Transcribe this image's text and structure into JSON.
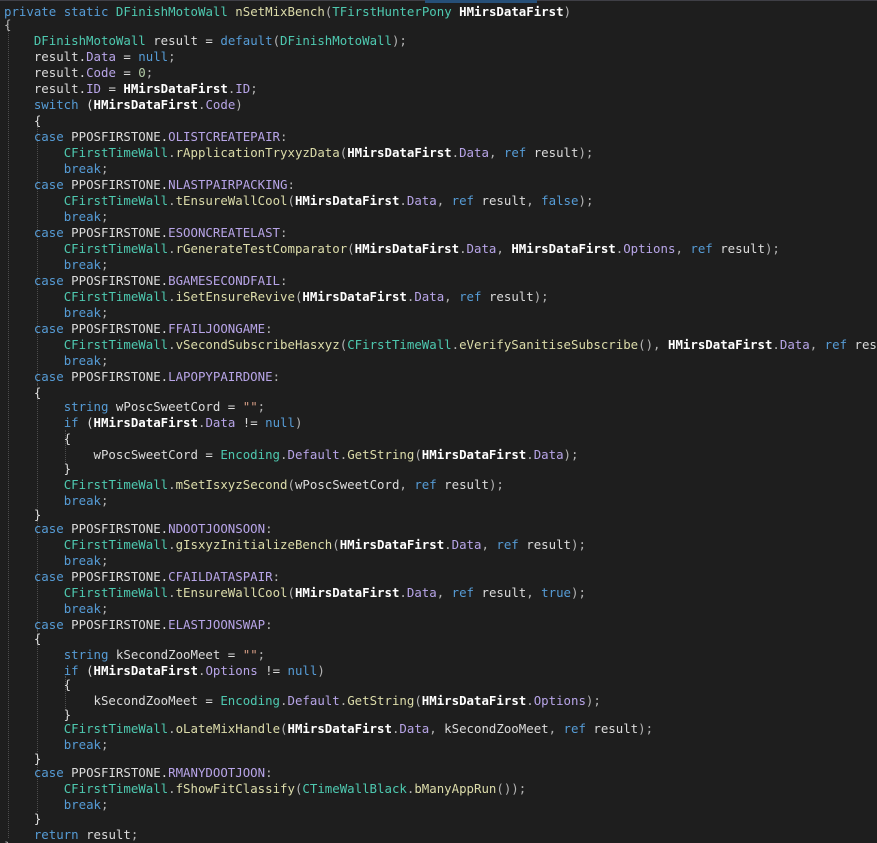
{
  "editor": {
    "language": "csharp",
    "colors": {
      "background": "#1e1e1e",
      "keyword": "#569cd6",
      "type": "#4ec9b0",
      "method": "#dcdcaa",
      "member": "#b8a5e8",
      "string": "#d69d85",
      "number": "#b5cea8",
      "text": "#dcdcdc"
    },
    "lines": [
      [
        [
          "kw",
          "private"
        ],
        [
          "var",
          " "
        ],
        [
          "kw",
          "static"
        ],
        [
          "var",
          " "
        ],
        [
          "ty",
          "DFinishMotoWall"
        ],
        [
          "var",
          " "
        ],
        [
          "fn",
          "nSetMixBench"
        ],
        [
          "pun",
          "("
        ],
        [
          "ty",
          "TFirstHunterPony"
        ],
        [
          "var",
          " "
        ],
        [
          "bold",
          "HMirsDataFirst"
        ],
        [
          "pun",
          ")"
        ]
      ],
      [
        [
          "pun",
          "{"
        ]
      ],
      [
        [
          "var",
          "    "
        ],
        [
          "ty",
          "DFinishMotoWall"
        ],
        [
          "var",
          " result = "
        ],
        [
          "kw",
          "default"
        ],
        [
          "pun",
          "("
        ],
        [
          "ty",
          "DFinishMotoWall"
        ],
        [
          "pun",
          ");"
        ]
      ],
      [
        [
          "var",
          "    result."
        ],
        [
          "pr",
          "Data"
        ],
        [
          "var",
          " = "
        ],
        [
          "kw",
          "null"
        ],
        [
          "pun",
          ";"
        ]
      ],
      [
        [
          "var",
          "    result."
        ],
        [
          "pr",
          "Code"
        ],
        [
          "var",
          " = "
        ],
        [
          "num",
          "0"
        ],
        [
          "pun",
          ";"
        ]
      ],
      [
        [
          "var",
          "    result."
        ],
        [
          "pr",
          "ID"
        ],
        [
          "var",
          " = "
        ],
        [
          "bold",
          "HMirsDataFirst"
        ],
        [
          "pun",
          "."
        ],
        [
          "pr",
          "ID"
        ],
        [
          "pun",
          ";"
        ]
      ],
      [
        [
          "var",
          "    "
        ],
        [
          "kw",
          "switch"
        ],
        [
          "var",
          " ("
        ],
        [
          "bold",
          "HMirsDataFirst"
        ],
        [
          "pun",
          "."
        ],
        [
          "pr",
          "Code"
        ],
        [
          "pun",
          ")"
        ]
      ],
      [
        [
          "var",
          "    {"
        ]
      ],
      [
        [
          "var",
          "    "
        ],
        [
          "kw",
          "case"
        ],
        [
          "var",
          " PPOSFIRSTONE."
        ],
        [
          "pr",
          "OLISTCREATEPAIR"
        ],
        [
          "pun",
          ":"
        ]
      ],
      [
        [
          "var",
          "        "
        ],
        [
          "ty",
          "CFirstTimeWall"
        ],
        [
          "pun",
          "."
        ],
        [
          "fn",
          "rApplicationTryxyzData"
        ],
        [
          "pun",
          "("
        ],
        [
          "bold",
          "HMirsDataFirst"
        ],
        [
          "pun",
          "."
        ],
        [
          "pr",
          "Data"
        ],
        [
          "pun",
          ", "
        ],
        [
          "kw",
          "ref"
        ],
        [
          "var",
          " result"
        ],
        [
          "pun",
          ");"
        ]
      ],
      [
        [
          "var",
          "        "
        ],
        [
          "kw",
          "break"
        ],
        [
          "pun",
          ";"
        ]
      ],
      [
        [
          "var",
          "    "
        ],
        [
          "kw",
          "case"
        ],
        [
          "var",
          " PPOSFIRSTONE."
        ],
        [
          "pr",
          "NLASTPAIRPACKING"
        ],
        [
          "pun",
          ":"
        ]
      ],
      [
        [
          "var",
          "        "
        ],
        [
          "ty",
          "CFirstTimeWall"
        ],
        [
          "pun",
          "."
        ],
        [
          "fn",
          "tEnsureWallCool"
        ],
        [
          "pun",
          "("
        ],
        [
          "bold",
          "HMirsDataFirst"
        ],
        [
          "pun",
          "."
        ],
        [
          "pr",
          "Data"
        ],
        [
          "pun",
          ", "
        ],
        [
          "kw",
          "ref"
        ],
        [
          "var",
          " result"
        ],
        [
          "pun",
          ", "
        ],
        [
          "kw",
          "false"
        ],
        [
          "pun",
          ");"
        ]
      ],
      [
        [
          "var",
          "        "
        ],
        [
          "kw",
          "break"
        ],
        [
          "pun",
          ";"
        ]
      ],
      [
        [
          "var",
          "    "
        ],
        [
          "kw",
          "case"
        ],
        [
          "var",
          " PPOSFIRSTONE."
        ],
        [
          "pr",
          "ESOONCREATELAST"
        ],
        [
          "pun",
          ":"
        ]
      ],
      [
        [
          "var",
          "        "
        ],
        [
          "ty",
          "CFirstTimeWall"
        ],
        [
          "pun",
          "."
        ],
        [
          "fn",
          "rGenerateTestComparator"
        ],
        [
          "pun",
          "("
        ],
        [
          "bold",
          "HMirsDataFirst"
        ],
        [
          "pun",
          "."
        ],
        [
          "pr",
          "Data"
        ],
        [
          "pun",
          ", "
        ],
        [
          "bold",
          "HMirsDataFirst"
        ],
        [
          "pun",
          "."
        ],
        [
          "pr",
          "Options"
        ],
        [
          "pun",
          ", "
        ],
        [
          "kw",
          "ref"
        ],
        [
          "var",
          " result"
        ],
        [
          "pun",
          ");"
        ]
      ],
      [
        [
          "var",
          "        "
        ],
        [
          "kw",
          "break"
        ],
        [
          "pun",
          ";"
        ]
      ],
      [
        [
          "var",
          "    "
        ],
        [
          "kw",
          "case"
        ],
        [
          "var",
          " PPOSFIRSTONE."
        ],
        [
          "pr",
          "BGAMESECONDFAIL"
        ],
        [
          "pun",
          ":"
        ]
      ],
      [
        [
          "var",
          "        "
        ],
        [
          "ty",
          "CFirstTimeWall"
        ],
        [
          "pun",
          "."
        ],
        [
          "fn",
          "iSetEnsureRevive"
        ],
        [
          "pun",
          "("
        ],
        [
          "bold",
          "HMirsDataFirst"
        ],
        [
          "pun",
          "."
        ],
        [
          "pr",
          "Data"
        ],
        [
          "pun",
          ", "
        ],
        [
          "kw",
          "ref"
        ],
        [
          "var",
          " result"
        ],
        [
          "pun",
          ");"
        ]
      ],
      [
        [
          "var",
          "        "
        ],
        [
          "kw",
          "break"
        ],
        [
          "pun",
          ";"
        ]
      ],
      [
        [
          "var",
          "    "
        ],
        [
          "kw",
          "case"
        ],
        [
          "var",
          " PPOSFIRSTONE."
        ],
        [
          "pr",
          "FFAILJOONGAME"
        ],
        [
          "pun",
          ":"
        ]
      ],
      [
        [
          "var",
          "        "
        ],
        [
          "ty",
          "CFirstTimeWall"
        ],
        [
          "pun",
          "."
        ],
        [
          "fn",
          "vSecondSubscribeHasxyz"
        ],
        [
          "pun",
          "("
        ],
        [
          "ty",
          "CFirstTimeWall"
        ],
        [
          "pun",
          "."
        ],
        [
          "fn",
          "eVerifySanitiseSubscribe"
        ],
        [
          "pun",
          "(), "
        ],
        [
          "bold",
          "HMirsDataFirst"
        ],
        [
          "pun",
          "."
        ],
        [
          "pr",
          "Data"
        ],
        [
          "pun",
          ", "
        ],
        [
          "kw",
          "ref"
        ],
        [
          "var",
          " result"
        ],
        [
          "pun",
          ");"
        ]
      ],
      [
        [
          "var",
          "        "
        ],
        [
          "kw",
          "break"
        ],
        [
          "pun",
          ";"
        ]
      ],
      [
        [
          "var",
          "    "
        ],
        [
          "kw",
          "case"
        ],
        [
          "var",
          " PPOSFIRSTONE."
        ],
        [
          "pr",
          "LAPOPYPAIRDONE"
        ],
        [
          "pun",
          ":"
        ]
      ],
      [
        [
          "var",
          "    {"
        ]
      ],
      [
        [
          "var",
          "        "
        ],
        [
          "kw",
          "string"
        ],
        [
          "var",
          " wPoscSweetCord = "
        ],
        [
          "str",
          "\"\""
        ],
        [
          "pun",
          ";"
        ]
      ],
      [
        [
          "var",
          "        "
        ],
        [
          "kw",
          "if"
        ],
        [
          "var",
          " ("
        ],
        [
          "bold",
          "HMirsDataFirst"
        ],
        [
          "pun",
          "."
        ],
        [
          "pr",
          "Data"
        ],
        [
          "var",
          " != "
        ],
        [
          "kw",
          "null"
        ],
        [
          "pun",
          ")"
        ]
      ],
      [
        [
          "var",
          "        {"
        ]
      ],
      [
        [
          "var",
          "            wPoscSweetCord = "
        ],
        [
          "ty",
          "Encoding"
        ],
        [
          "pun",
          "."
        ],
        [
          "pr",
          "Default"
        ],
        [
          "pun",
          "."
        ],
        [
          "fn",
          "GetString"
        ],
        [
          "pun",
          "("
        ],
        [
          "bold",
          "HMirsDataFirst"
        ],
        [
          "pun",
          "."
        ],
        [
          "pr",
          "Data"
        ],
        [
          "pun",
          ");"
        ]
      ],
      [
        [
          "var",
          "        }"
        ]
      ],
      [
        [
          "var",
          "        "
        ],
        [
          "ty",
          "CFirstTimeWall"
        ],
        [
          "pun",
          "."
        ],
        [
          "fn",
          "mSetIsxyzSecond"
        ],
        [
          "pun",
          "("
        ],
        [
          "var",
          "wPoscSweetCord"
        ],
        [
          "pun",
          ", "
        ],
        [
          "kw",
          "ref"
        ],
        [
          "var",
          " result"
        ],
        [
          "pun",
          ");"
        ]
      ],
      [
        [
          "var",
          "        "
        ],
        [
          "kw",
          "break"
        ],
        [
          "pun",
          ";"
        ]
      ],
      [
        [
          "var",
          "    }"
        ]
      ],
      [
        [
          "var",
          "    "
        ],
        [
          "kw",
          "case"
        ],
        [
          "var",
          " PPOSFIRSTONE."
        ],
        [
          "pr",
          "NDOOTJOONSOON"
        ],
        [
          "pun",
          ":"
        ]
      ],
      [
        [
          "var",
          "        "
        ],
        [
          "ty",
          "CFirstTimeWall"
        ],
        [
          "pun",
          "."
        ],
        [
          "fn",
          "gIsxyzInitializeBench"
        ],
        [
          "pun",
          "("
        ],
        [
          "bold",
          "HMirsDataFirst"
        ],
        [
          "pun",
          "."
        ],
        [
          "pr",
          "Data"
        ],
        [
          "pun",
          ", "
        ],
        [
          "kw",
          "ref"
        ],
        [
          "var",
          " result"
        ],
        [
          "pun",
          ");"
        ]
      ],
      [
        [
          "var",
          "        "
        ],
        [
          "kw",
          "break"
        ],
        [
          "pun",
          ";"
        ]
      ],
      [
        [
          "var",
          "    "
        ],
        [
          "kw",
          "case"
        ],
        [
          "var",
          " PPOSFIRSTONE."
        ],
        [
          "pr",
          "CFAILDATASPAIR"
        ],
        [
          "pun",
          ":"
        ]
      ],
      [
        [
          "var",
          "        "
        ],
        [
          "ty",
          "CFirstTimeWall"
        ],
        [
          "pun",
          "."
        ],
        [
          "fn",
          "tEnsureWallCool"
        ],
        [
          "pun",
          "("
        ],
        [
          "bold",
          "HMirsDataFirst"
        ],
        [
          "pun",
          "."
        ],
        [
          "pr",
          "Data"
        ],
        [
          "pun",
          ", "
        ],
        [
          "kw",
          "ref"
        ],
        [
          "var",
          " result"
        ],
        [
          "pun",
          ", "
        ],
        [
          "kw",
          "true"
        ],
        [
          "pun",
          ");"
        ]
      ],
      [
        [
          "var",
          "        "
        ],
        [
          "kw",
          "break"
        ],
        [
          "pun",
          ";"
        ]
      ],
      [
        [
          "var",
          "    "
        ],
        [
          "kw",
          "case"
        ],
        [
          "var",
          " PPOSFIRSTONE."
        ],
        [
          "pr",
          "ELASTJOONSWAP"
        ],
        [
          "pun",
          ":"
        ]
      ],
      [
        [
          "var",
          "    {"
        ]
      ],
      [
        [
          "var",
          "        "
        ],
        [
          "kw",
          "string"
        ],
        [
          "var",
          " kSecondZooMeet = "
        ],
        [
          "str",
          "\"\""
        ],
        [
          "pun",
          ";"
        ]
      ],
      [
        [
          "var",
          "        "
        ],
        [
          "kw",
          "if"
        ],
        [
          "var",
          " ("
        ],
        [
          "bold",
          "HMirsDataFirst"
        ],
        [
          "pun",
          "."
        ],
        [
          "pr",
          "Options"
        ],
        [
          "var",
          " != "
        ],
        [
          "kw",
          "null"
        ],
        [
          "pun",
          ")"
        ]
      ],
      [
        [
          "var",
          "        {"
        ]
      ],
      [
        [
          "var",
          "            kSecondZooMeet = "
        ],
        [
          "ty",
          "Encoding"
        ],
        [
          "pun",
          "."
        ],
        [
          "pr",
          "Default"
        ],
        [
          "pun",
          "."
        ],
        [
          "fn",
          "GetString"
        ],
        [
          "pun",
          "("
        ],
        [
          "bold",
          "HMirsDataFirst"
        ],
        [
          "pun",
          "."
        ],
        [
          "pr",
          "Options"
        ],
        [
          "pun",
          ");"
        ]
      ],
      [
        [
          "var",
          "        }"
        ]
      ],
      [
        [
          "var",
          "        "
        ],
        [
          "ty",
          "CFirstTimeWall"
        ],
        [
          "pun",
          "."
        ],
        [
          "fn",
          "oLateMixHandle"
        ],
        [
          "pun",
          "("
        ],
        [
          "bold",
          "HMirsDataFirst"
        ],
        [
          "pun",
          "."
        ],
        [
          "pr",
          "Data"
        ],
        [
          "pun",
          ", "
        ],
        [
          "var",
          "kSecondZooMeet"
        ],
        [
          "pun",
          ", "
        ],
        [
          "kw",
          "ref"
        ],
        [
          "var",
          " result"
        ],
        [
          "pun",
          ");"
        ]
      ],
      [
        [
          "var",
          "        "
        ],
        [
          "kw",
          "break"
        ],
        [
          "pun",
          ";"
        ]
      ],
      [
        [
          "var",
          "    }"
        ]
      ],
      [
        [
          "var",
          "    "
        ],
        [
          "kw",
          "case"
        ],
        [
          "var",
          " PPOSFIRSTONE."
        ],
        [
          "pr",
          "RMANYDOOTJOON"
        ],
        [
          "pun",
          ":"
        ]
      ],
      [
        [
          "var",
          "        "
        ],
        [
          "ty",
          "CFirstTimeWall"
        ],
        [
          "pun",
          "."
        ],
        [
          "fn",
          "fShowFitClassify"
        ],
        [
          "pun",
          "("
        ],
        [
          "ty",
          "CTimeWallBlack"
        ],
        [
          "pun",
          "."
        ],
        [
          "fn",
          "bManyAppRun"
        ],
        [
          "pun",
          "());"
        ]
      ],
      [
        [
          "var",
          "        "
        ],
        [
          "kw",
          "break"
        ],
        [
          "pun",
          ";"
        ]
      ],
      [
        [
          "var",
          "    }"
        ]
      ],
      [
        [
          "var",
          "    "
        ],
        [
          "kw",
          "return"
        ],
        [
          "var",
          " result"
        ],
        [
          "pun",
          ";"
        ]
      ],
      [
        [
          "pun",
          "}"
        ]
      ]
    ]
  }
}
